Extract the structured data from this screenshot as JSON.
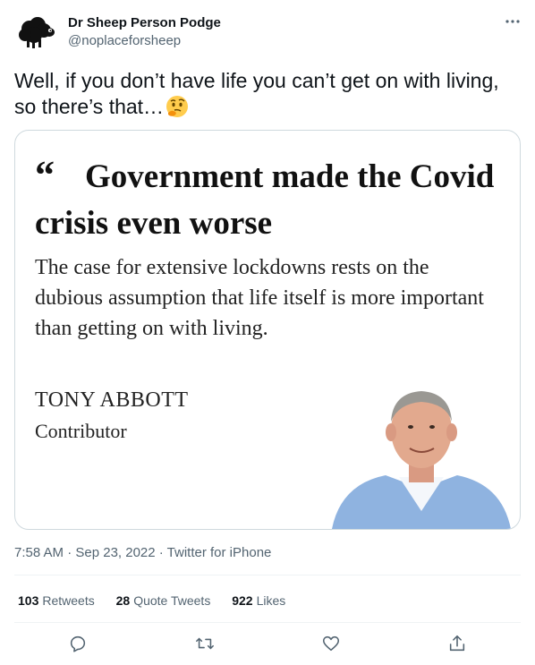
{
  "user": {
    "display_name": "Dr Sheep Person Podge",
    "handle": "@noplaceforsheep"
  },
  "tweet": {
    "text": "Well, if you don’t have life you can’t get on with living, so there’s that…",
    "emoji": "thinking-face"
  },
  "media": {
    "quote_mark": "“",
    "headline": "Government made the Covid crisis even worse",
    "deck": "The case for extensive lockdowns rests on the dubious assumption that life itself is more important than getting on with living.",
    "author": "TONY ABBOTT",
    "role": "Contributor"
  },
  "meta": {
    "timestamp": "7:58 AM · Sep 23, 2022 · Twitter for iPhone"
  },
  "stats": {
    "retweets_count": "103",
    "retweets_label": "Retweets",
    "quotes_count": "28",
    "quotes_label": "Quote Tweets",
    "likes_count": "922",
    "likes_label": "Likes"
  },
  "actions": [
    "reply-icon",
    "retweet-icon",
    "like-icon",
    "share-icon"
  ],
  "colors": {
    "text": "#0f1419",
    "secondary": "#536471",
    "border": "#cfd9de"
  }
}
